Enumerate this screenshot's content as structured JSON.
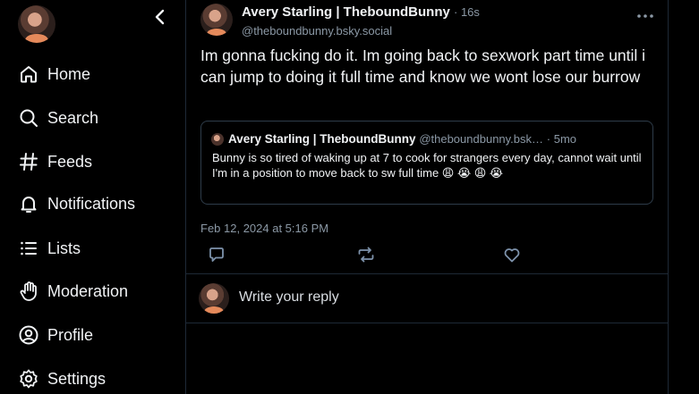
{
  "sidebar": {
    "items": [
      {
        "label": "Home",
        "icon": "home-icon"
      },
      {
        "label": "Search",
        "icon": "search-icon"
      },
      {
        "label": "Feeds",
        "icon": "hash-icon"
      },
      {
        "label": "Notifications",
        "icon": "bell-icon"
      },
      {
        "label": "Lists",
        "icon": "list-icon"
      },
      {
        "label": "Moderation",
        "icon": "hand-icon"
      },
      {
        "label": "Profile",
        "icon": "user-icon"
      },
      {
        "label": "Settings",
        "icon": "gear-icon"
      }
    ]
  },
  "post": {
    "author_name": "Avery Starling | TheboundBunny",
    "time": "· 16s",
    "handle": "@theboundbunny.bsky.social",
    "text": "Im gonna fucking do it. Im going back to sexwork part time until i can jump to doing it full time and know we wont lose our burrow",
    "date": "Feb 12, 2024 at 5:16 PM"
  },
  "quote": {
    "author_name": "Avery Starling | TheboundBunny",
    "handle": "@theboundbunny.bsk…",
    "time": "· 5mo",
    "text": "Bunny is so tired of waking up at 7 to cook for strangers every day, cannot wait until I'm in a position to move back to sw full time 😩 😭 😩 😭"
  },
  "reply": {
    "placeholder": "Write your reply"
  },
  "colors": {
    "background": "#000000",
    "border": "#1e2936",
    "muted_text": "#8b98a5",
    "text": "#f1f3f5"
  }
}
